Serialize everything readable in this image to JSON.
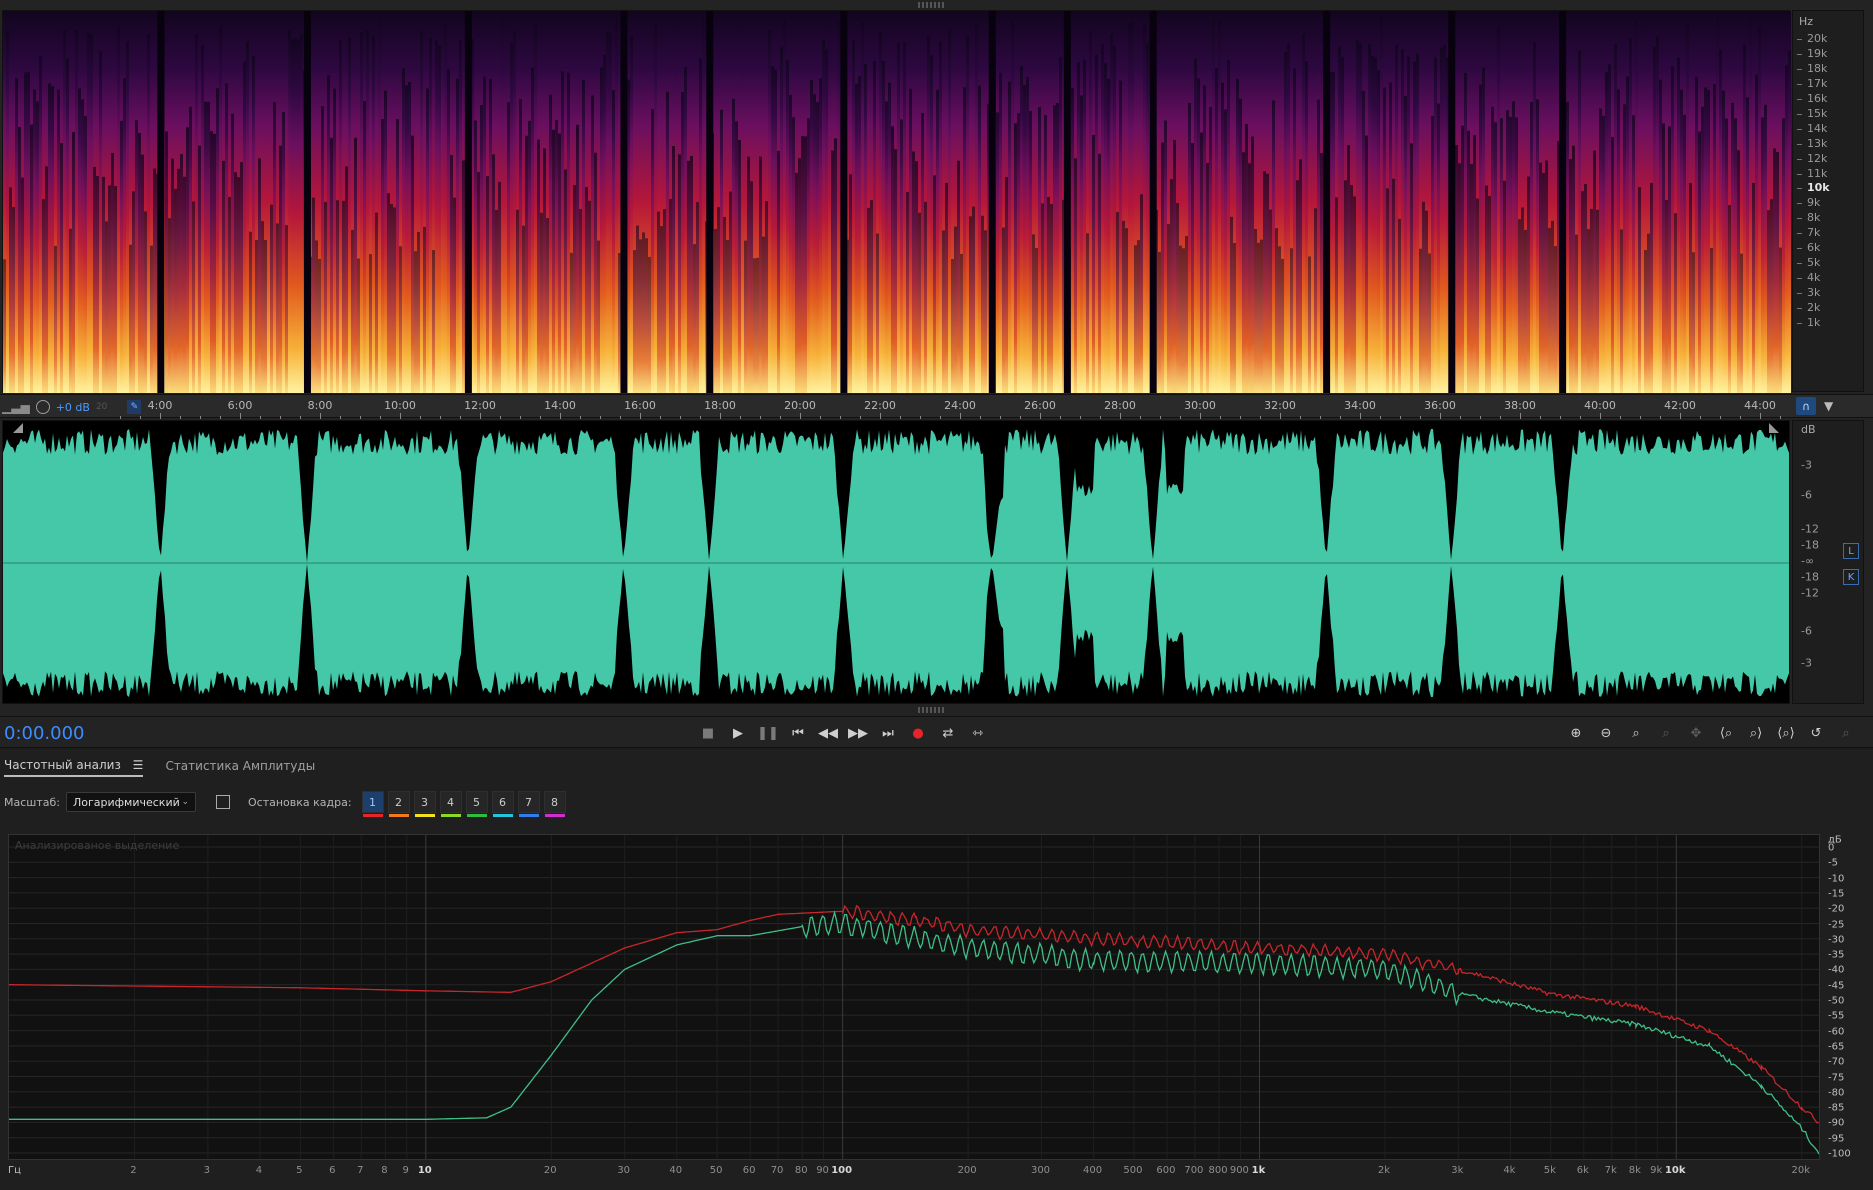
{
  "spectrogram": {
    "unit": "Hz",
    "freq_labels": [
      "20k",
      "19k",
      "18k",
      "17k",
      "16k",
      "15k",
      "14k",
      "13k",
      "12k",
      "11k",
      "10k",
      "9k",
      "8k",
      "7k",
      "6k",
      "5k",
      "4k",
      "3k",
      "2k",
      "1k"
    ],
    "bold_label": "10k"
  },
  "timeline": {
    "gain": "+0 dB",
    "gain_ghost": "20",
    "labels": [
      "4:00",
      "6:00",
      "8:00",
      "10:00",
      "12:00",
      "14:00",
      "16:00",
      "18:00",
      "20:00",
      "22:00",
      "24:00",
      "26:00",
      "28:00",
      "30:00",
      "32:00",
      "34:00",
      "36:00",
      "38:00",
      "40:00",
      "42:00",
      "44:00"
    ]
  },
  "waveform": {
    "unit": "dB",
    "db_labels": [
      "-3",
      "-6",
      "-12",
      "-18",
      "-∞",
      "-18",
      "-12",
      "-6",
      "-3"
    ],
    "channel_l": "L",
    "channel_r": "K",
    "color": "#45c8a8",
    "gaps": [
      0.088,
      0.17,
      0.26,
      0.347,
      0.395,
      0.47,
      0.553,
      0.595,
      0.643,
      0.74,
      0.81,
      0.872
    ]
  },
  "transport": {
    "time": "0:00.000",
    "buttons": [
      "stop",
      "play",
      "pause",
      "to-start",
      "rewind",
      "fast-forward",
      "to-end",
      "record",
      "loop",
      "skip-selection"
    ]
  },
  "panel": {
    "tabs": [
      {
        "label": "Частотный анализ",
        "active": true,
        "menu": "☰"
      },
      {
        "label": "Статистика Амплитуды",
        "active": false
      }
    ],
    "scale_label": "Масштаб:",
    "scale_value": "Логарифмический",
    "freeze_label": "Остановка кадра:",
    "frames": [
      {
        "n": "1",
        "color": "#e8242a",
        "active": true
      },
      {
        "n": "2",
        "color": "#f07a1e",
        "active": false
      },
      {
        "n": "3",
        "color": "#f4e21e",
        "active": false
      },
      {
        "n": "4",
        "color": "#8bdb1e",
        "active": false
      },
      {
        "n": "5",
        "color": "#2fbe3c",
        "active": false
      },
      {
        "n": "6",
        "color": "#23c6dc",
        "active": false
      },
      {
        "n": "7",
        "color": "#2f7ef0",
        "active": false
      },
      {
        "n": "8",
        "color": "#d02fd0",
        "active": false
      }
    ],
    "watermark": "Анализированое выделение",
    "db_unit": "дБ",
    "db_ticks": [
      "0",
      "-5",
      "-10",
      "-15",
      "-20",
      "-25",
      "-30",
      "-35",
      "-40",
      "-45",
      "-50",
      "-55",
      "-60",
      "-65",
      "-70",
      "-75",
      "-80",
      "-85",
      "-90",
      "-95",
      "-100"
    ],
    "freq_unit": "Гц",
    "freq_ticks": [
      {
        "f": 2,
        "t": "2"
      },
      {
        "f": 3,
        "t": "3"
      },
      {
        "f": 4,
        "t": "4"
      },
      {
        "f": 5,
        "t": "5"
      },
      {
        "f": 6,
        "t": "6"
      },
      {
        "f": 7,
        "t": "7"
      },
      {
        "f": 8,
        "t": "8"
      },
      {
        "f": 9,
        "t": "9"
      },
      {
        "f": 10,
        "t": "10",
        "major": true
      },
      {
        "f": 20,
        "t": "20"
      },
      {
        "f": 30,
        "t": "30"
      },
      {
        "f": 40,
        "t": "40"
      },
      {
        "f": 50,
        "t": "50"
      },
      {
        "f": 60,
        "t": "60"
      },
      {
        "f": 70,
        "t": "70"
      },
      {
        "f": 80,
        "t": "80"
      },
      {
        "f": 90,
        "t": "90"
      },
      {
        "f": 100,
        "t": "100",
        "major": true
      },
      {
        "f": 200,
        "t": "200"
      },
      {
        "f": 300,
        "t": "300"
      },
      {
        "f": 400,
        "t": "400"
      },
      {
        "f": 500,
        "t": "500"
      },
      {
        "f": 600,
        "t": "600"
      },
      {
        "f": 700,
        "t": "700"
      },
      {
        "f": 800,
        "t": "800"
      },
      {
        "f": 900,
        "t": "900"
      },
      {
        "f": 1000,
        "t": "1k",
        "major": true
      },
      {
        "f": 2000,
        "t": "2k"
      },
      {
        "f": 3000,
        "t": "3k"
      },
      {
        "f": 4000,
        "t": "4k"
      },
      {
        "f": 5000,
        "t": "5k"
      },
      {
        "f": 6000,
        "t": "6k"
      },
      {
        "f": 7000,
        "t": "7k"
      },
      {
        "f": 8000,
        "t": "8k"
      },
      {
        "f": 9000,
        "t": "9k"
      },
      {
        "f": 10000,
        "t": "10k",
        "major": true
      },
      {
        "f": 20000,
        "t": "20k"
      }
    ],
    "series": [
      {
        "name": "peak",
        "color": "#c8262a",
        "points": [
          [
            1,
            -45
          ],
          [
            5,
            -46
          ],
          [
            10,
            -47
          ],
          [
            16,
            -47.5
          ],
          [
            20,
            -44
          ],
          [
            30,
            -33
          ],
          [
            40,
            -28
          ],
          [
            50,
            -27
          ],
          [
            60,
            -24
          ],
          [
            70,
            -22
          ],
          [
            100,
            -21
          ],
          [
            150,
            -24
          ],
          [
            200,
            -27
          ],
          [
            400,
            -30
          ],
          [
            1000,
            -33
          ],
          [
            2000,
            -35
          ],
          [
            3000,
            -40
          ],
          [
            5000,
            -48
          ],
          [
            8000,
            -52
          ],
          [
            12000,
            -60
          ],
          [
            16000,
            -72
          ],
          [
            20000,
            -85
          ],
          [
            22000,
            -90
          ]
        ]
      },
      {
        "name": "avg",
        "color": "#3fbf87",
        "points": [
          [
            1,
            -89
          ],
          [
            10,
            -89
          ],
          [
            14,
            -88.5
          ],
          [
            16,
            -85
          ],
          [
            20,
            -68
          ],
          [
            25,
            -50
          ],
          [
            30,
            -40
          ],
          [
            40,
            -32
          ],
          [
            50,
            -29
          ],
          [
            60,
            -29
          ],
          [
            80,
            -26
          ],
          [
            100,
            -25
          ],
          [
            200,
            -33
          ],
          [
            400,
            -37
          ],
          [
            1000,
            -38
          ],
          [
            2000,
            -40
          ],
          [
            3000,
            -48
          ],
          [
            5000,
            -54
          ],
          [
            8000,
            -58
          ],
          [
            12000,
            -65
          ],
          [
            16000,
            -78
          ],
          [
            20000,
            -92
          ],
          [
            22000,
            -100
          ]
        ]
      }
    ]
  }
}
